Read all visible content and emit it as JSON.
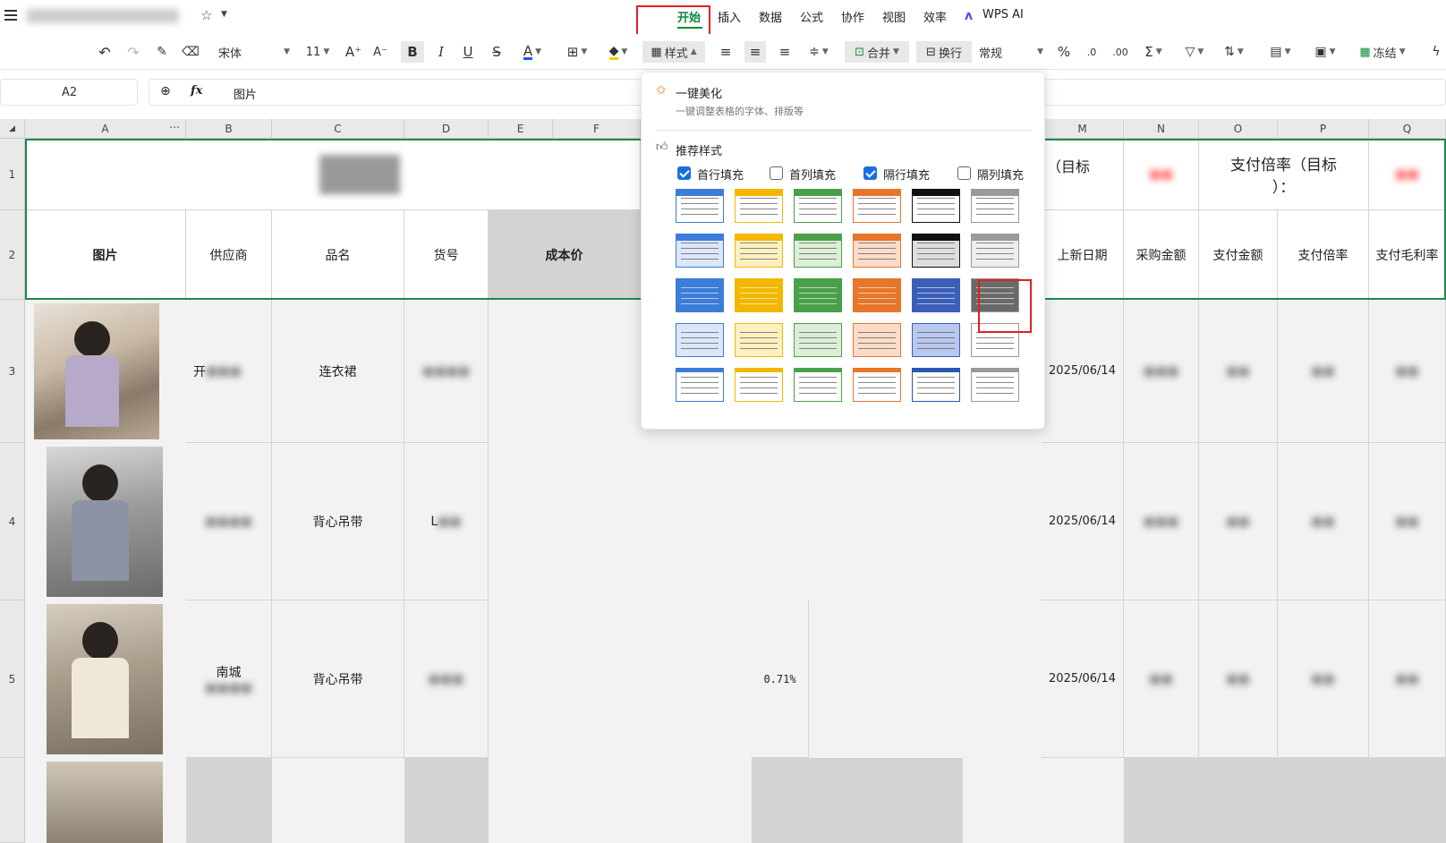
{
  "topbar": {
    "menu": [
      "开始",
      "插入",
      "数据",
      "公式",
      "协作",
      "视图",
      "效率",
      "WPS AI"
    ]
  },
  "toolbar": {
    "font": "宋体",
    "size": "11",
    "style_label": "样式",
    "merge_label": "合并",
    "wrap_label": "换行",
    "format": "常规",
    "freeze_label": "冻结"
  },
  "formula_bar": {
    "cell_ref": "A2",
    "fx": "fx",
    "content": "图片"
  },
  "columns": [
    "A",
    "B",
    "C",
    "D",
    "E",
    "F",
    "M",
    "N",
    "O",
    "P",
    "Q"
  ],
  "rows": [
    "1",
    "2",
    "3",
    "4",
    "5"
  ],
  "header_row": {
    "A": "图片",
    "B": "供应商",
    "C": "品名",
    "D": "货号",
    "E": "成本价",
    "M": "上新日期",
    "N": "采购金额",
    "O": "支付金额",
    "P": "支付倍率",
    "Q": "支付毛利率"
  },
  "row1": {
    "M": "（目标",
    "O": "支付倍率（目标",
    "O2": "）："
  },
  "data_rows": [
    {
      "row": "3",
      "B": "开",
      "C": "连衣裙",
      "M": "2025/06/14"
    },
    {
      "row": "4",
      "C": "背心吊带",
      "D": "L",
      "M": "2025/06/14"
    },
    {
      "row": "5",
      "B": "南城",
      "C": "背心吊带",
      "pct": "0.71%",
      "M": "2025/06/14"
    }
  ],
  "popup": {
    "beautify_title": "一键美化",
    "beautify_desc": "一键调整表格的字体、排版等",
    "recommended": "推荐样式",
    "options": [
      {
        "label": "首行填充",
        "checked": true
      },
      {
        "label": "首列填充",
        "checked": false
      },
      {
        "label": "隔行填充",
        "checked": true
      },
      {
        "label": "隔列填充",
        "checked": false
      }
    ]
  },
  "palette": {
    "accent": "#0a8a3a",
    "select_red": "#e02020",
    "check_blue": "#1a6fe0"
  }
}
